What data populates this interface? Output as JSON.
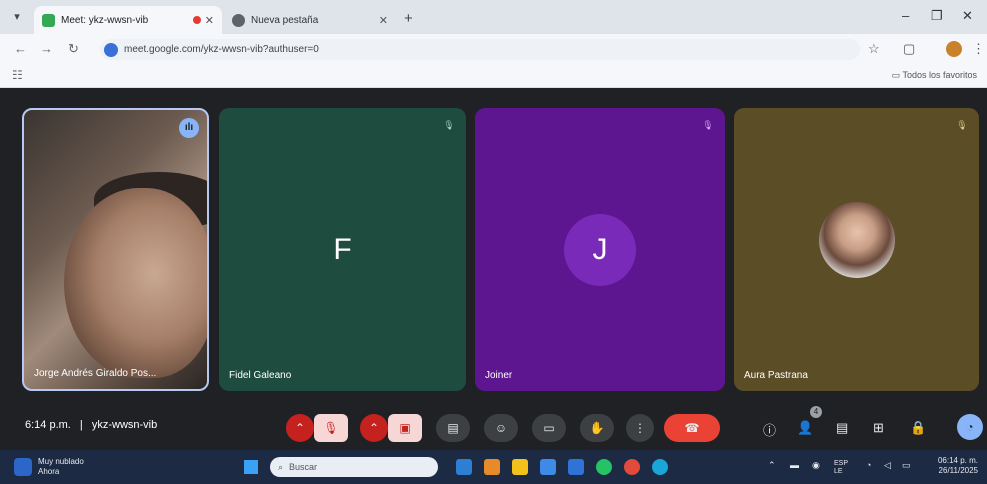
{
  "browser": {
    "tabs": [
      {
        "title": "Meet: ykz-wwsn-vib",
        "active": true
      },
      {
        "title": "Nueva pestaña",
        "active": false
      }
    ],
    "url": "meet.google.com/ykz-wwsn-vib?authuser=0",
    "bookmarks_label": "Todos los favoritos"
  },
  "meet": {
    "participants": [
      {
        "name": "Jorge Andrés Giraldo Pos...",
        "initial": "",
        "bg": "#3a3431",
        "speaking": true
      },
      {
        "name": "Fidel Galeano",
        "initial": "F",
        "bg": "#1e4d3f"
      },
      {
        "name": "Joiner",
        "initial": "J",
        "bg": "#5e1590"
      },
      {
        "name": "Aura Pastrana",
        "initial": "",
        "bg": "#5b4e26"
      }
    ],
    "time": "6:14 p.m.",
    "separator": "|",
    "code": "ykz-wwsn-vib",
    "people_count": "4"
  },
  "taskbar": {
    "weather_line1": "Muy nublado",
    "weather_line2": "Ahora",
    "search_placeholder": "Buscar",
    "lang_line1": "ESP",
    "lang_line2": "LE",
    "clock_line1": "06:14 p. m.",
    "clock_line2": "26/11/2025"
  },
  "colors": {
    "meet_bg": "#202124",
    "end_call": "#ea4335",
    "accent": "#8ab4f8"
  }
}
